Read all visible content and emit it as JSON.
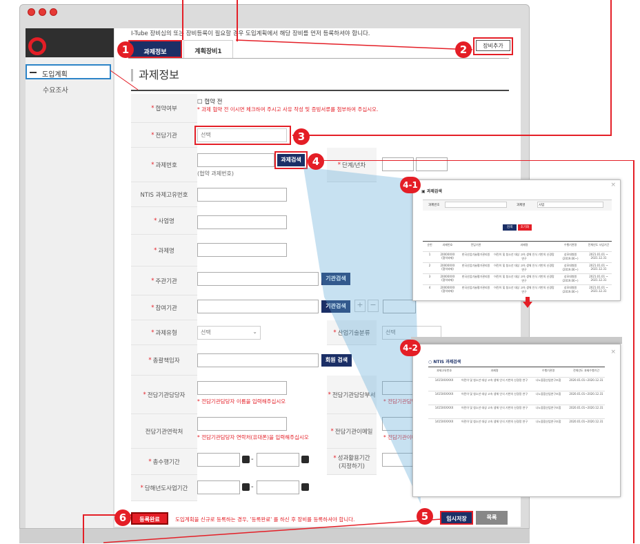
{
  "window": {
    "dot_color": "#e53935"
  },
  "notice": "I-Tube 장비심의 또는 장비등록이 필요할 경우 도입계획에서 해당 장비를 먼저 등록하셔야 합니다.",
  "tabs": [
    {
      "label": "과제정보",
      "mini": "과제정보"
    },
    {
      "label": "계획장비1"
    }
  ],
  "equip_add_label": "장비추가",
  "sidebar": {
    "items": [
      {
        "label": "도입계획"
      },
      {
        "label": "수요조사"
      }
    ]
  },
  "page_title": "과제정보",
  "form": {
    "agreement": {
      "label": "협약여부",
      "checkbox_label": "협약 전",
      "note": "* 과제 협약 전 이시면 체크하여 주시고 사유 작성 및 증빙서류를 첨부하여 주십시오."
    },
    "agency": {
      "label": "전담기관",
      "value": "선택"
    },
    "task_no": {
      "label": "과제번호",
      "search_label": "과제검색",
      "hint": "(협약 과제번호)",
      "stage_label": "단계/년차"
    },
    "ntis": {
      "label": "NTIS 과제고유번호"
    },
    "project": {
      "label": "사업명"
    },
    "task_name": {
      "label": "과제명"
    },
    "host": {
      "label": "주관기관",
      "search_label": "기관검색"
    },
    "partner": {
      "label": "참여기관",
      "search_label": "기관검색",
      "plus": "+",
      "minus": "−"
    },
    "task_type": {
      "label": "과제유형",
      "value": "선택",
      "industry_label": "산업기술분류",
      "industry_value": "선택"
    },
    "manager": {
      "label": "총괄책임자",
      "search_label": "회원 검색"
    },
    "agency_person": {
      "label": "전담기관담당자",
      "note": "* 전담기관담당자 이름을 입력해주십시오",
      "dept_label": "전담기관담당부서",
      "dept_note": "* 전담기관담당"
    },
    "agency_contact": {
      "label": "전담기관연락처",
      "note": "* 전담기관담당자 연락처(유대폰)을 입력해주십시오",
      "email_label": "전담기관이메일",
      "email_note": "* 전담기관이메"
    },
    "period": {
      "label": "총수행기간",
      "dash": "-",
      "outcome_label": "성과활용기간",
      "outcome_sub": "(지정하기)"
    },
    "year_period": {
      "label": "당해년도사업기간",
      "dash": "-"
    }
  },
  "bottom": {
    "complete_label": "등록완료",
    "note": "도입계획을 신규로 등록하는 경우, '등록완료' 를 하신 후 장비를 등록하셔야 합니다.",
    "temp_save_label": "임시저장",
    "list_label": "목록"
  },
  "popup1": {
    "title": "과제검색",
    "f1_label": "과제번호",
    "f2_label": "과제명",
    "f2_value": "사업",
    "search": "검색",
    "reset": "초기화",
    "headers": [
      "순번",
      "과제번호",
      "전담기관",
      "과제명",
      "수행기관명",
      "전체년도 사업기간"
    ],
    "rows": [
      [
        "1",
        "20000XXX\n(협약과제)",
        "한국산업기술평가관리원",
        "어린이 및 청소년 대상 고속 생체 인식 기반의 신경망 연구",
        "성모대병원\n(2019.06~)",
        "2021.01.01 ~\n2021.12.31"
      ],
      [
        "2",
        "20000XXX\n(협약과제)",
        "한국산업기술평가관리원",
        "어린이 및 청소년 대상 고속 생체 인식 기반의 신경망 연구",
        "성모대병원\n(2019.06~)",
        "2021.01.01 ~\n2021.12.31"
      ],
      [
        "3",
        "20000XXX\n(협약과제)",
        "한국산업기술평가관리원",
        "어린이 및 청소년 대상 고속 생체 인식 기반의 신경망 연구",
        "성모대병원\n(2019.06~)",
        "2021.01.01 ~\n2021.12.31"
      ],
      [
        "4",
        "20000XXX\n(협약과제)",
        "한국산업기술평가관리원",
        "어린이 및 청소년 대상 고속 생체 인식 기반의 신경망 연구",
        "성모대병원\n(2019.06~)",
        "2021.01.01 ~\n2021.12.31"
      ]
    ]
  },
  "popup2": {
    "title": "NTIS 과제검색",
    "headers": [
      "과제고유번호",
      "과제명",
      "수행기관명",
      "전체년도 과제수행기간"
    ],
    "rows": [
      [
        "1415XXXXXX",
        "어린이 및 청소년 대상 고속 생체 인식 기반의 신경망 연구",
        "나노융합산업연구조합",
        "2020.01.01~2020.12.31"
      ],
      [
        "1415XXXXXX",
        "어린이 및 청소년 대상 고속 생체 인식 기반의 신경망 연구",
        "나노융합산업연구조합",
        "2020.01.01~2020.12.31"
      ],
      [
        "1415XXXXXX",
        "어린이 및 청소년 대상 고속 생체 인식 기반의 신경망 연구",
        "나노융합산업연구조합",
        "2020.01.01~2020.12.31"
      ],
      [
        "1415XXXXXX",
        "어린이 및 청소년 대상 고속 생체 인식 기반의 신경망 연구",
        "나노융합산업연구조합",
        "2020.01.01~2020.12.31"
      ]
    ]
  },
  "badges": [
    "1",
    "2",
    "3",
    "4",
    "4-1",
    "4-2",
    "5",
    "6"
  ]
}
